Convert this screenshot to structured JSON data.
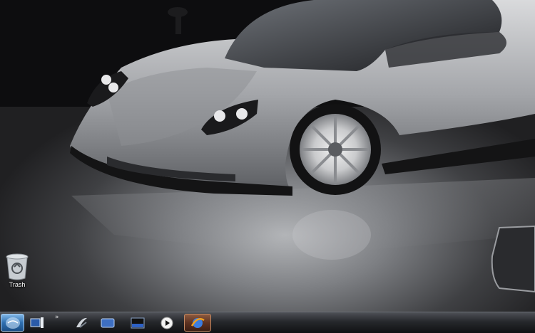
{
  "desktop": {
    "wallpaper": "silver-supercar",
    "icons": [
      {
        "label": "Trash",
        "icon": "trash-icon"
      }
    ]
  },
  "taskbar": {
    "start_icon": "windows-orb-icon",
    "overflow_glyph": "»",
    "items": [
      {
        "icon": "show-desktop-icon",
        "active": false
      },
      {
        "icon": "app-logo-icon",
        "active": false
      },
      {
        "icon": "window-icon",
        "active": false
      },
      {
        "icon": "media-window-icon",
        "active": false
      },
      {
        "icon": "play-icon",
        "active": false
      },
      {
        "icon": "browser-icon",
        "active": true
      }
    ]
  },
  "colors": {
    "taskbar_bg": "#26282c",
    "start_blue": "#2f6fb0",
    "active_task": "#5e3221"
  }
}
